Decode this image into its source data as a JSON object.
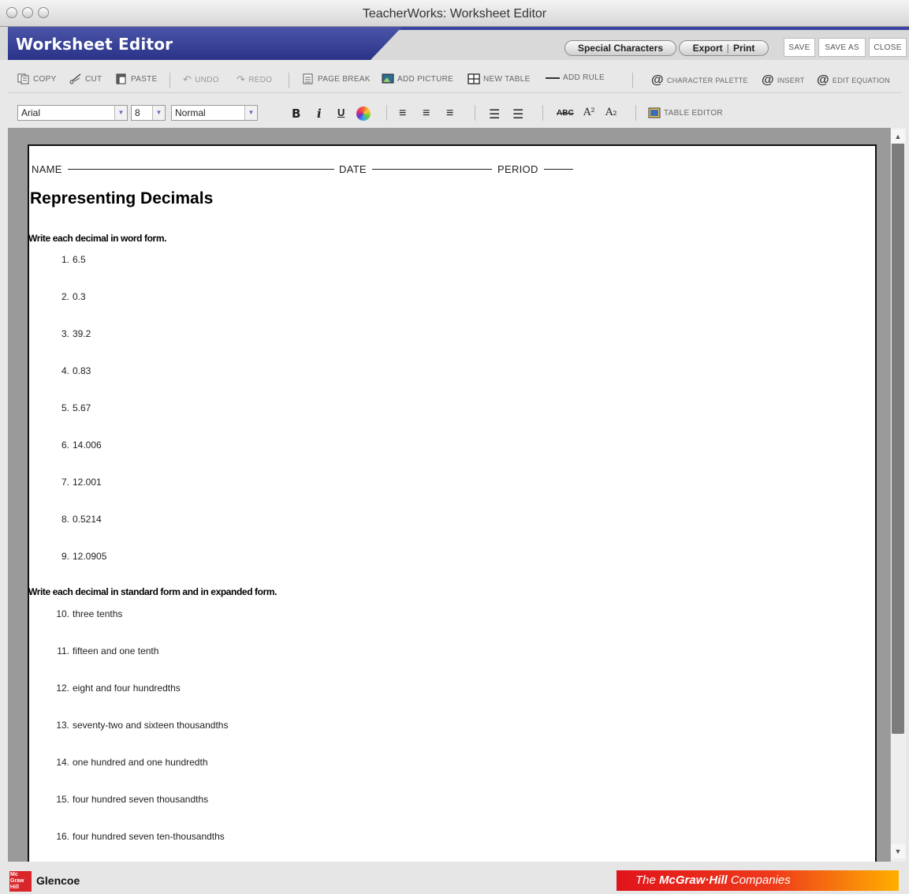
{
  "window": {
    "title": "TeacherWorks: Worksheet Editor"
  },
  "header": {
    "app_title": "Worksheet Editor",
    "special_characters": "Special Characters",
    "export": "Export",
    "print": "Print",
    "save": "SAVE",
    "save_as": "SAVE AS",
    "close": "CLOSE"
  },
  "toolbar": {
    "copy": "COPY",
    "cut": "CUT",
    "paste": "PASTE",
    "undo": "UNDO",
    "redo": "REDO",
    "page_break": "PAGE BREAK",
    "add_picture": "ADD PICTURE",
    "new_table": "NEW TABLE",
    "add_rule": "ADD RULE",
    "character_palette": "CHARACTER PALETTE",
    "insert": "INSERT",
    "edit_equation": "EDIT EQUATION",
    "table_editor": "TABLE EDITOR"
  },
  "format": {
    "font": "Arial",
    "size": "8",
    "style": "Normal",
    "bold": "B",
    "italic": "i",
    "underline": "U",
    "strike": "ABC",
    "superscript": "A²",
    "subscript": "A₂"
  },
  "document": {
    "name_label": "NAME",
    "date_label": "DATE",
    "period_label": "PERIOD",
    "title": "Representing Decimals",
    "section1": "Write each decimal in word form.",
    "items1": [
      {
        "n": "1.",
        "t": "6.5"
      },
      {
        "n": "2.",
        "t": "0.3"
      },
      {
        "n": "3.",
        "t": "39.2"
      },
      {
        "n": "4.",
        "t": "0.83"
      },
      {
        "n": "5.",
        "t": "5.67"
      },
      {
        "n": "6.",
        "t": "14.006"
      },
      {
        "n": "7.",
        "t": "12.001"
      },
      {
        "n": "8.",
        "t": "0.5214"
      },
      {
        "n": "9.",
        "t": "12.0905"
      }
    ],
    "section2": "Write each decimal in standard form and in expanded form.",
    "items2": [
      {
        "n": "10.",
        "t": "three tenths"
      },
      {
        "n": "11.",
        "t": "fifteen and one tenth"
      },
      {
        "n": "12.",
        "t": "eight and four hundredths"
      },
      {
        "n": "13.",
        "t": "seventy-two and sixteen thousandths"
      },
      {
        "n": "14.",
        "t": "one hundred and one hundredth"
      },
      {
        "n": "15.",
        "t": "four hundred seven thousandths"
      },
      {
        "n": "16.",
        "t": "four hundred seven ten-thousandths"
      }
    ]
  },
  "footer": {
    "logo_text": "Mc Graw Hill",
    "glencoe": "Glencoe",
    "company_prefix": "The ",
    "company_name": "McGraw·Hill",
    "company_suffix": " Companies"
  }
}
